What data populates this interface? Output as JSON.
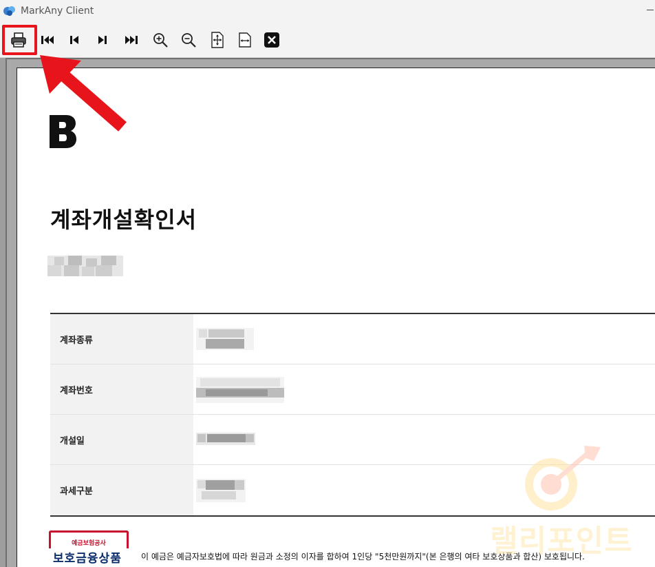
{
  "window": {
    "title": "MarkAny Client"
  },
  "toolbar": {
    "buttons": [
      {
        "name": "print",
        "icon": "printer-icon"
      },
      {
        "name": "first-page",
        "icon": "skip-first-icon"
      },
      {
        "name": "previous-page",
        "icon": "previous-icon"
      },
      {
        "name": "next-page",
        "icon": "next-icon"
      },
      {
        "name": "last-page",
        "icon": "skip-last-icon"
      },
      {
        "name": "zoom-in",
        "icon": "zoom-in-icon"
      },
      {
        "name": "zoom-out",
        "icon": "zoom-out-icon"
      },
      {
        "name": "fit-page",
        "icon": "fit-page-icon"
      },
      {
        "name": "fit-width",
        "icon": "fit-width-icon"
      },
      {
        "name": "close",
        "icon": "close-icon"
      }
    ],
    "highlight_color": "#e8141b"
  },
  "document": {
    "title": "계좌개설확인서",
    "rows": [
      {
        "label": "계좌종류"
      },
      {
        "label": "계좌번호"
      },
      {
        "label": "개설일"
      },
      {
        "label": "과세구분"
      }
    ],
    "badge_top": "예금보험공사",
    "badge_main": "보호금융상품",
    "deposit_notice": "이 예금은 예금자보호법에 따라 원금과 소정의 이자를 합하여 1인당 \"5천만원까지\"(본 은행의 여타 보호상품과 합산) 보호됩니다."
  },
  "watermark": {
    "text": "랠리포인트"
  }
}
